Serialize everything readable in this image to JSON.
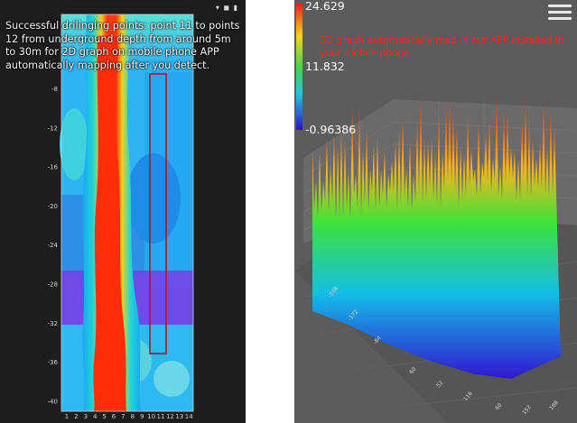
{
  "left_panel": {
    "caption": "Successful drilinging points: point 11 to points 12 from underground depth from around 5m to 30m for 2D graph on mobile phone APP automatically mapping after you detect.",
    "y_ticks": [
      "-8",
      "-12",
      "-16",
      "-20",
      "-24",
      "-28",
      "-32",
      "-36",
      "-40"
    ],
    "x_ticks": [
      "1",
      "2",
      "3",
      "4",
      "5",
      "6",
      "7",
      "8",
      "9",
      "10",
      "11",
      "12",
      "13",
      "14"
    ],
    "status_icons": "▾ ◼ ▮"
  },
  "right_panel": {
    "caption": "3D graph automatically map in our APP installed in your mobile phone",
    "legend": {
      "max": "24.629",
      "mid": "11.832",
      "min": "-0.96386"
    },
    "axis_labels": [
      "-108",
      "-172",
      "-84",
      "60",
      "52",
      "116",
      "60",
      "152",
      "188"
    ]
  },
  "colors": {
    "caption_right": "#ff2424",
    "background_right": "#5c5c5c",
    "background_left": "#1d1d1d"
  }
}
